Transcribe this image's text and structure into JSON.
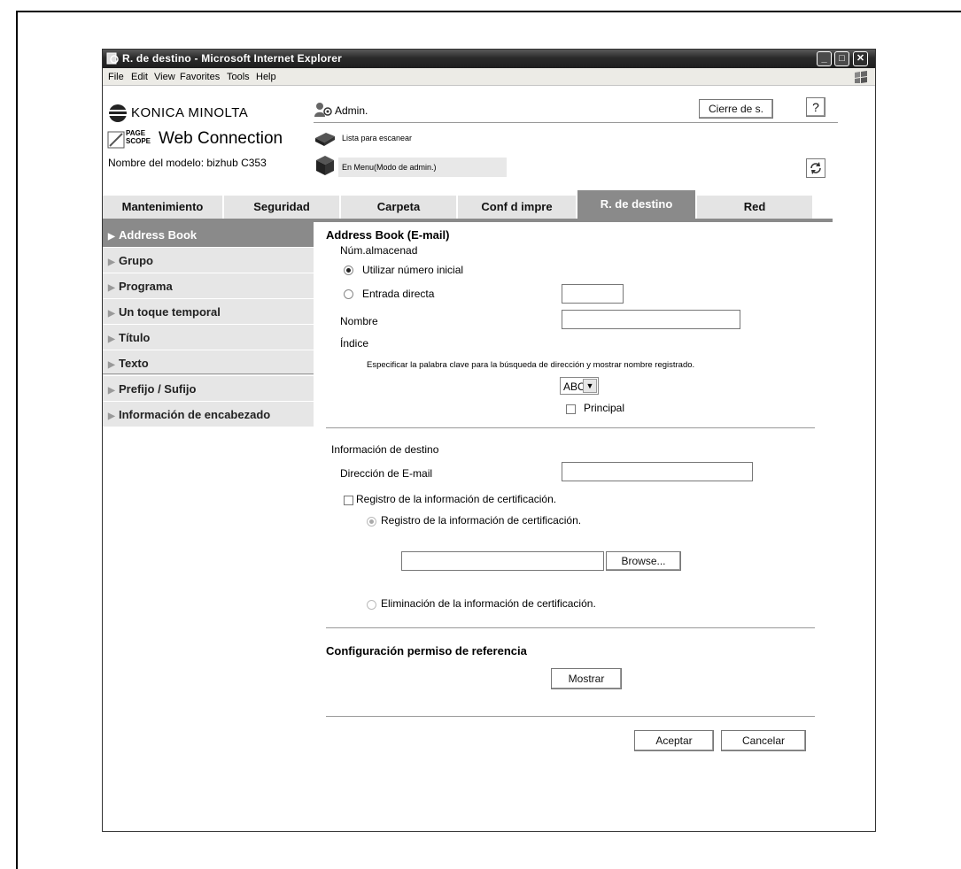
{
  "window": {
    "title": "R. de destino - Microsoft Internet Explorer",
    "minimize": "_",
    "maximize": "□",
    "close": "✕"
  },
  "menu": [
    "File",
    "Edit",
    "View",
    "Favorites",
    "Tools",
    "Help"
  ],
  "header": {
    "brand": "KONICA MINOLTA",
    "page_scope_top": "PAGE",
    "page_scope_bottom": "SCOPE",
    "web_connection": "Web Connection",
    "model": "Nombre del modelo: bizhub C353",
    "admin_label": "Admin.",
    "logout_button": "Cierre de s.",
    "help_button": "?",
    "status_scan": "Lista para escanear",
    "status_mode": "En Menu(Modo de admin.)"
  },
  "tabs": [
    {
      "label": "Mantenimiento",
      "active": false
    },
    {
      "label": "Seguridad",
      "active": false
    },
    {
      "label": "Carpeta",
      "active": false
    },
    {
      "label": "Conf d impre",
      "active": false
    },
    {
      "label": "R. de destino",
      "active": true
    },
    {
      "label": "Red",
      "active": false
    }
  ],
  "sidebar": [
    {
      "label": "Address Book",
      "active": true
    },
    {
      "label": "Grupo",
      "active": false
    },
    {
      "label": "Programa",
      "active": false
    },
    {
      "label": "Un toque temporal",
      "active": false
    },
    {
      "label": "Título",
      "active": false
    },
    {
      "label": "Texto",
      "active": false
    },
    {
      "label": "Prefijo / Sufijo",
      "active": false
    },
    {
      "label": "Información de encabezado",
      "active": false
    }
  ],
  "form": {
    "heading": "Address Book (E-mail)",
    "storage_label": "Núm.almacenad",
    "use_initial": "Utilizar número inicial",
    "direct_entry": "Entrada directa",
    "name_label": "Nombre",
    "index_label": "Índice",
    "index_hint": "Especificar la palabra clave para la búsqueda de dirección y mostrar nombre registrado.",
    "index_select": "ABC",
    "principal": "Principal",
    "dest_info": "Información de destino",
    "email_label": "Dirección de E-mail",
    "cert_reg_check": "Registro de la información de certificación.",
    "cert_reg_radio": "Registro de la información de certificación.",
    "browse": "Browse...",
    "cert_delete": "Eliminación de la información de certificación.",
    "ref_heading": "Configuración permiso de referencia",
    "show": "Mostrar",
    "accept": "Aceptar",
    "cancel": "Cancelar"
  }
}
